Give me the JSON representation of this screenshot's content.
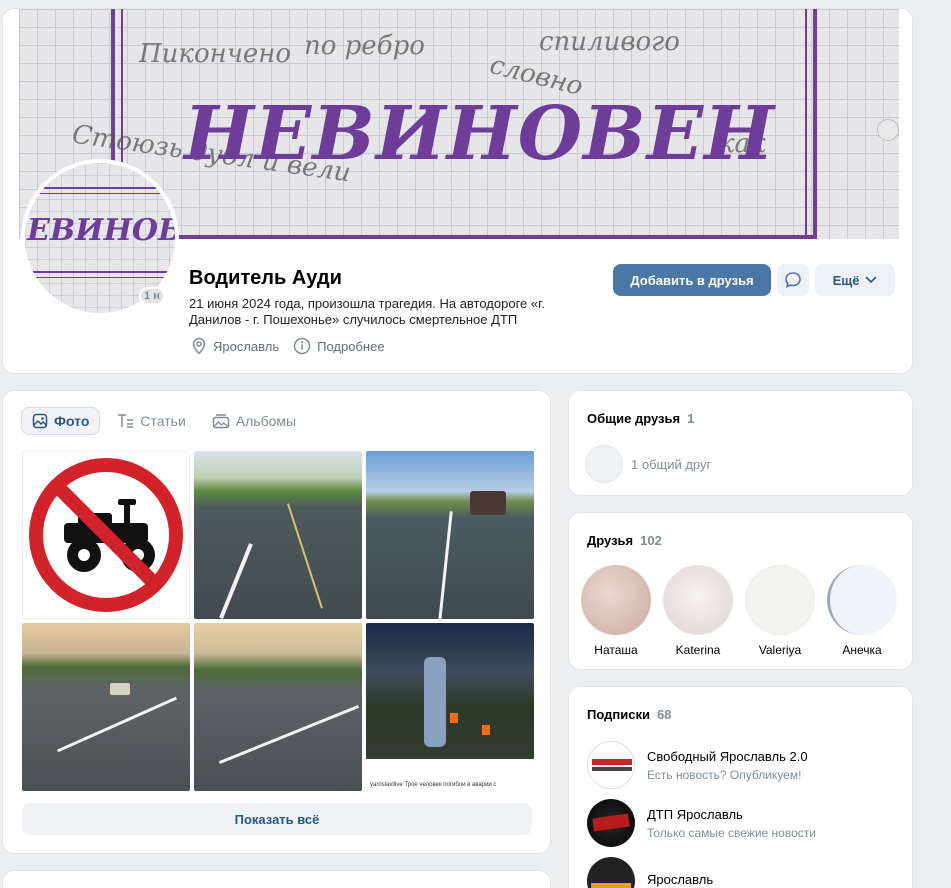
{
  "colors": {
    "accent": "#4a76a8",
    "link": "#2a5885",
    "muted": "#818c99",
    "cover_purple": "#6e3d99"
  },
  "cover": {
    "title": "НЕВИНОВЕН",
    "scribbles": [
      "Пикончено",
      "по ребро",
      "словно",
      "Стоюзь дубл и вели",
      "спиливого",
      "как"
    ]
  },
  "avatar": {
    "text": "ЕВИНОВЕ",
    "online_label": "1 н"
  },
  "profile": {
    "name": "Водитель Ауди",
    "status": "21 июня 2024 года, произошла трагедия. На автодороге «г. Данилов - г. Пошехонье» случилось смертельное ДТП",
    "location": "Ярославль",
    "details_label": "Подробнее"
  },
  "actions": {
    "add_friend": "Добавить в друзья",
    "more": "Ещё"
  },
  "photos": {
    "tabs": [
      {
        "label": "Фото",
        "icon": "photo-icon",
        "active": true
      },
      {
        "label": "Статьи",
        "icon": "articles-icon",
        "active": false
      },
      {
        "label": "Альбомы",
        "icon": "albums-icon",
        "active": false
      }
    ],
    "instagram_caption": "yaroslavllive Трое человек погибли в аварии с",
    "show_all": "Показать всё"
  },
  "mutual_friends": {
    "title": "Общие друзья",
    "count": "1",
    "summary": "1 общий друг"
  },
  "friends": {
    "title": "Друзья",
    "count": "102",
    "items": [
      {
        "name": "Наташа",
        "color": "#e8cfc7"
      },
      {
        "name": "Katerina",
        "color": "#f3eeee"
      },
      {
        "name": "Valeriya",
        "color": "#f1f1ef"
      },
      {
        "name": "Анечка",
        "color": "#eef2f8"
      }
    ]
  },
  "subscriptions": {
    "title": "Подписки",
    "count": "68",
    "items": [
      {
        "name": "Свободный Ярославль 2.0",
        "desc": "Есть новость? Опубликуем!"
      },
      {
        "name": "ДТП Ярославль",
        "desc": "Только самые свежие новости"
      },
      {
        "name": "Ярославль",
        "desc": ""
      }
    ]
  }
}
